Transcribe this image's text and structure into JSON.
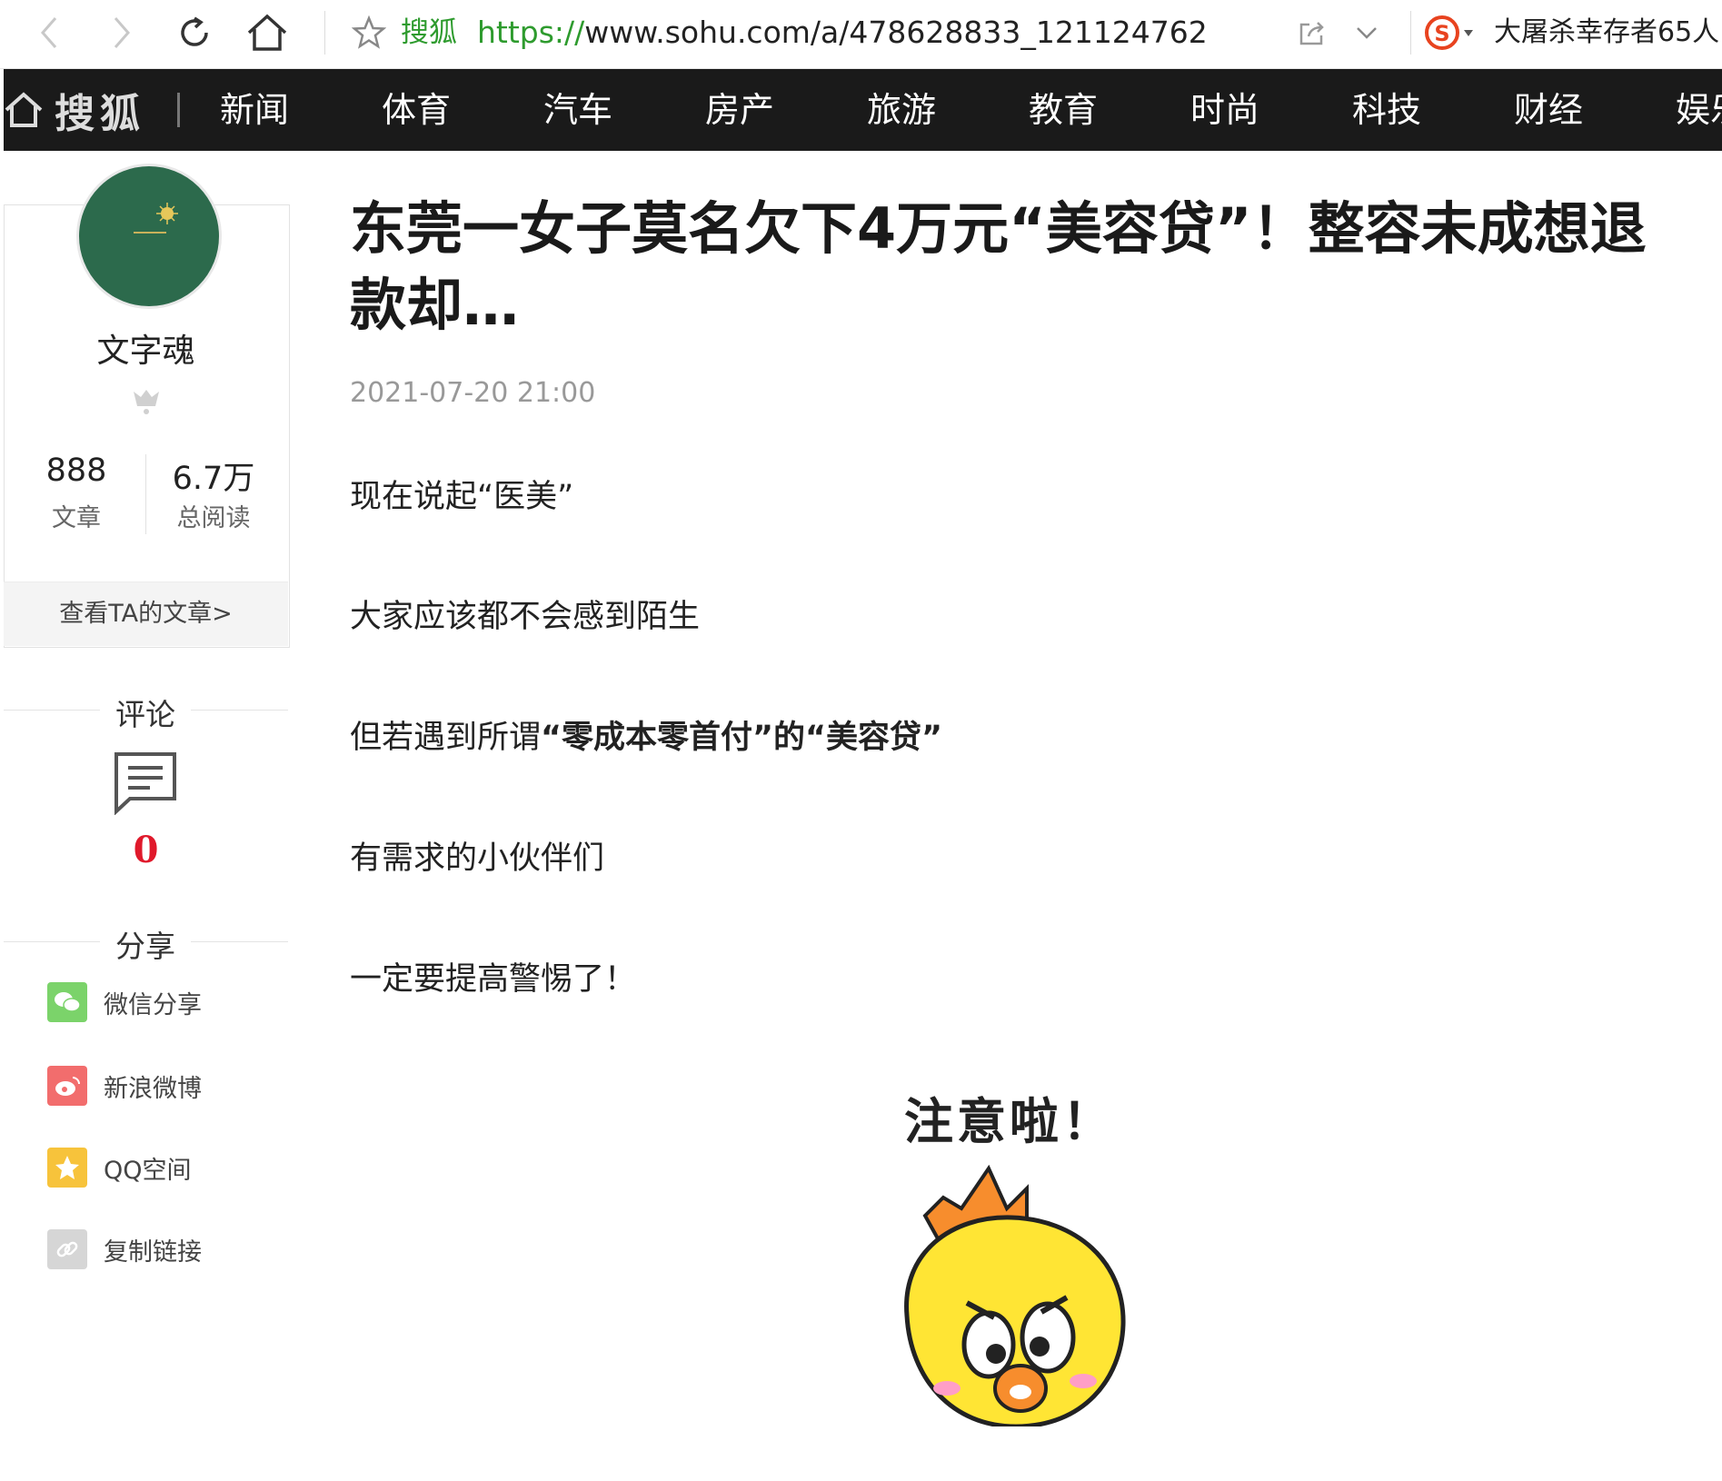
{
  "browser": {
    "site_name": "搜狐",
    "url_protocol": "https://",
    "url_rest": "www.sohu.com/a/478628833_121124762",
    "search_text": "大屠杀幸存者65人"
  },
  "nav": {
    "logo": "搜狐",
    "items": [
      "新闻",
      "体育",
      "汽车",
      "房产",
      "旅游",
      "教育",
      "时尚",
      "科技",
      "财经",
      "娱乐"
    ]
  },
  "author": {
    "name": "文字魂",
    "articles_count": "888",
    "articles_label": "文章",
    "reads_count": "6.7万",
    "reads_label": "总阅读",
    "view_articles_link": "查看TA的文章>"
  },
  "sidebar": {
    "comment_title": "评论",
    "comment_count": "0",
    "share_title": "分享",
    "share_items": [
      {
        "label": "微信分享",
        "icon": "wechat-icon",
        "color": "#7bd36a"
      },
      {
        "label": "新浪微博",
        "icon": "weibo-icon",
        "color": "#f26d6d"
      },
      {
        "label": "QQ空间",
        "icon": "qzone-icon",
        "color": "#f7c33b"
      },
      {
        "label": "复制链接",
        "icon": "link-icon",
        "color": "#d6d6d6"
      }
    ]
  },
  "article": {
    "title": "东莞一女子莫名欠下4万元“美容贷”！整容未成想退款却…",
    "date": "2021-07-20 21:00",
    "paragraphs": [
      "现在说起“医美”",
      "大家应该都不会感到陌生",
      "有需求的小伙伴们",
      "一定要提高警惕了！"
    ],
    "para3_prefix": "但若遇到所谓",
    "para3_bold": "“零成本零首付”的“美容贷”",
    "sticker_text": "注意啦！"
  },
  "colors": {
    "nav_bg": "#1a1a1a",
    "accent_green": "#2e9b2e",
    "comment_red": "#e0192b"
  }
}
